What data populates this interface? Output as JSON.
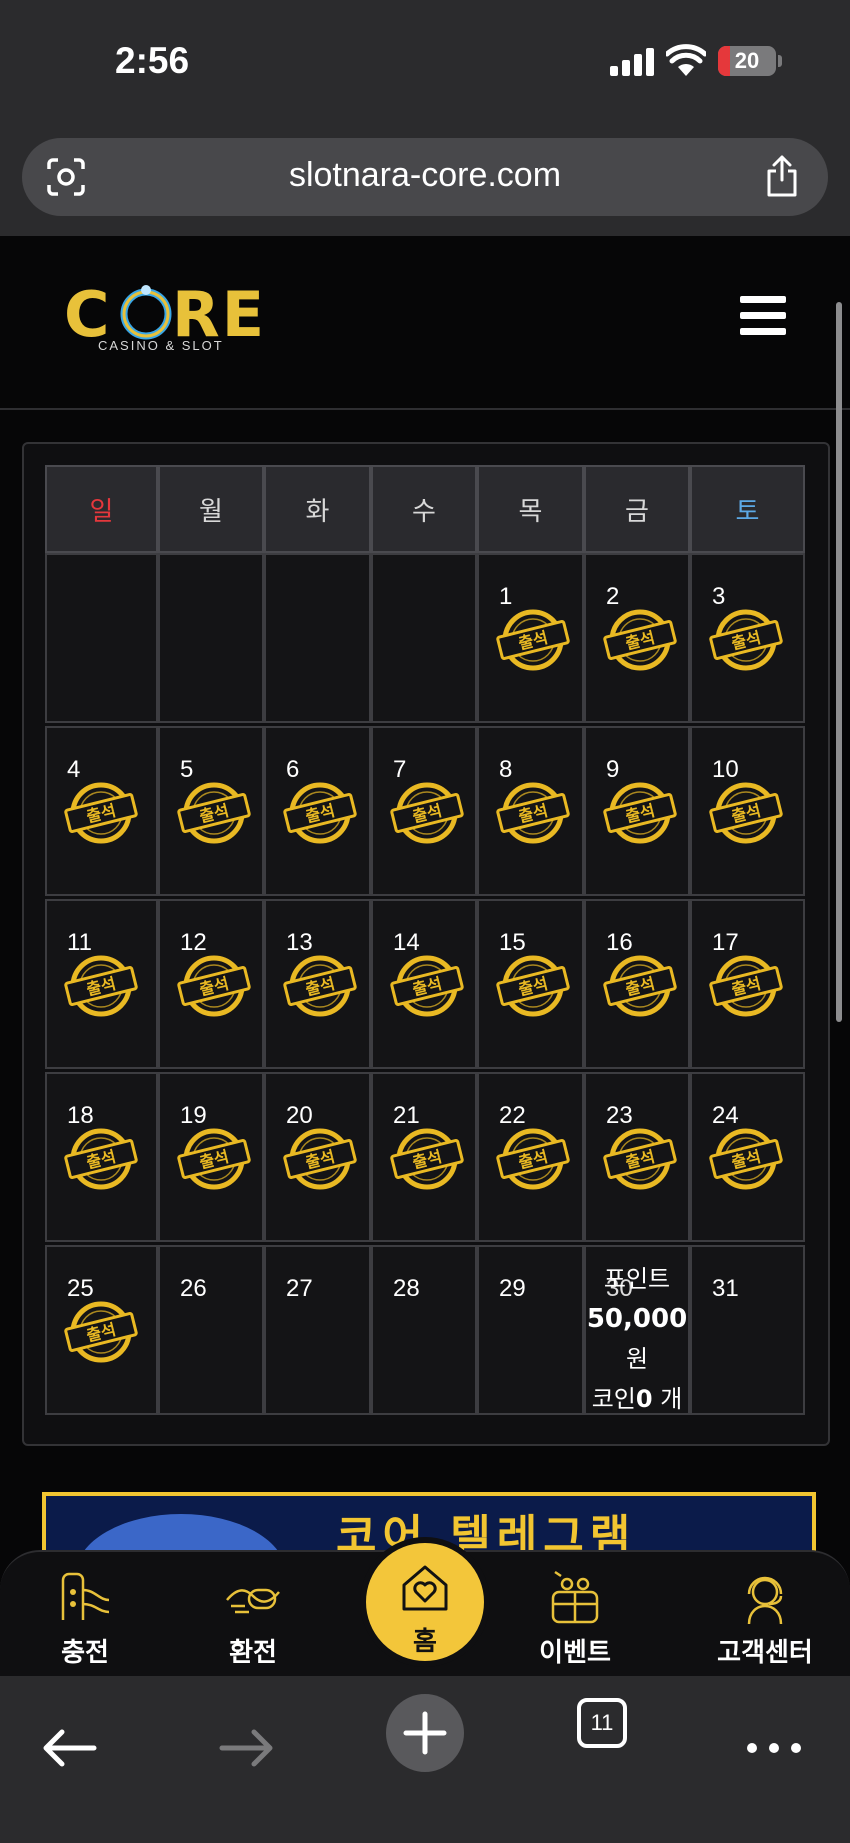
{
  "status_bar": {
    "time": "2:56",
    "battery": "20",
    "battery_level": 0.2
  },
  "browser": {
    "url": "slotnara-core.com",
    "tab_count": "11"
  },
  "site": {
    "logo_text": "CORE",
    "logo_tagline": "CASINO & SLOT",
    "logo_colors": {
      "gold": "#e8c13a",
      "ring": "#3aa7e6"
    }
  },
  "calendar": {
    "weekdays": [
      "일",
      "월",
      "화",
      "수",
      "목",
      "금",
      "토"
    ],
    "stamp_label": "출석",
    "stamp_color": "#e9b923",
    "weeks": [
      [
        null,
        null,
        null,
        null,
        {
          "day": "1",
          "stamp": true
        },
        {
          "day": "2",
          "stamp": true
        },
        {
          "day": "3",
          "stamp": true
        }
      ],
      [
        {
          "day": "4",
          "stamp": true
        },
        {
          "day": "5",
          "stamp": true
        },
        {
          "day": "6",
          "stamp": true
        },
        {
          "day": "7",
          "stamp": true
        },
        {
          "day": "8",
          "stamp": true
        },
        {
          "day": "9",
          "stamp": true
        },
        {
          "day": "10",
          "stamp": true
        }
      ],
      [
        {
          "day": "11",
          "stamp": true
        },
        {
          "day": "12",
          "stamp": true
        },
        {
          "day": "13",
          "stamp": true
        },
        {
          "day": "14",
          "stamp": true
        },
        {
          "day": "15",
          "stamp": true
        },
        {
          "day": "16",
          "stamp": true
        },
        {
          "day": "17",
          "stamp": true
        }
      ],
      [
        {
          "day": "18",
          "stamp": true
        },
        {
          "day": "19",
          "stamp": true
        },
        {
          "day": "20",
          "stamp": true
        },
        {
          "day": "21",
          "stamp": true
        },
        {
          "day": "22",
          "stamp": true
        },
        {
          "day": "23",
          "stamp": true
        },
        {
          "day": "24",
          "stamp": true
        }
      ],
      [
        {
          "day": "25",
          "stamp": true
        },
        {
          "day": "26",
          "stamp": false
        },
        {
          "day": "27",
          "stamp": false
        },
        {
          "day": "28",
          "stamp": false
        },
        {
          "day": "29",
          "stamp": false
        },
        {
          "day": "30",
          "stamp": false,
          "note": true
        },
        {
          "day": "31",
          "stamp": false
        }
      ]
    ],
    "today_note": {
      "line1": "포인트",
      "points": "50,000",
      "unit": "원",
      "coin_prefix": "코인",
      "coins": "0",
      "coin_unit": "개"
    }
  },
  "banner": {
    "text": "코어 텔레그램"
  },
  "bottom_nav": {
    "charge": "충전",
    "exchange": "환전",
    "home": "홈",
    "event": "이벤트",
    "support": "고객센터"
  }
}
